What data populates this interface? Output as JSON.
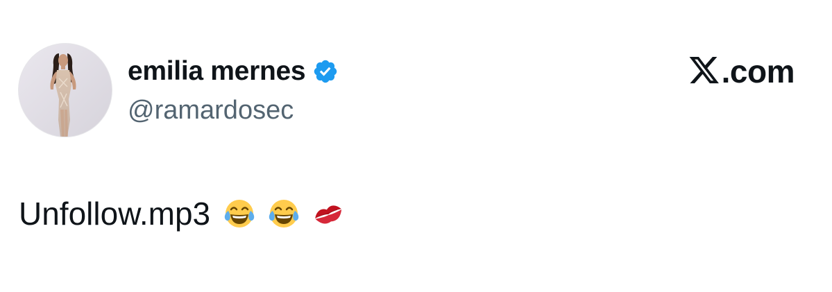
{
  "profile": {
    "display_name": "emilia mernes",
    "handle": "@ramardosec",
    "verified": true,
    "avatar": "avatar-photo"
  },
  "brand": {
    "logo": "x-logo-icon",
    "text": ".com"
  },
  "tweet": {
    "text": "Unfollow.mp3",
    "emojis": [
      "face-with-tears-of-joy",
      "face-with-tears-of-joy",
      "kiss-mark"
    ]
  },
  "colors": {
    "verified_blue": "#1d9bf0",
    "handle_gray": "#536471",
    "text": "#0f1419"
  }
}
